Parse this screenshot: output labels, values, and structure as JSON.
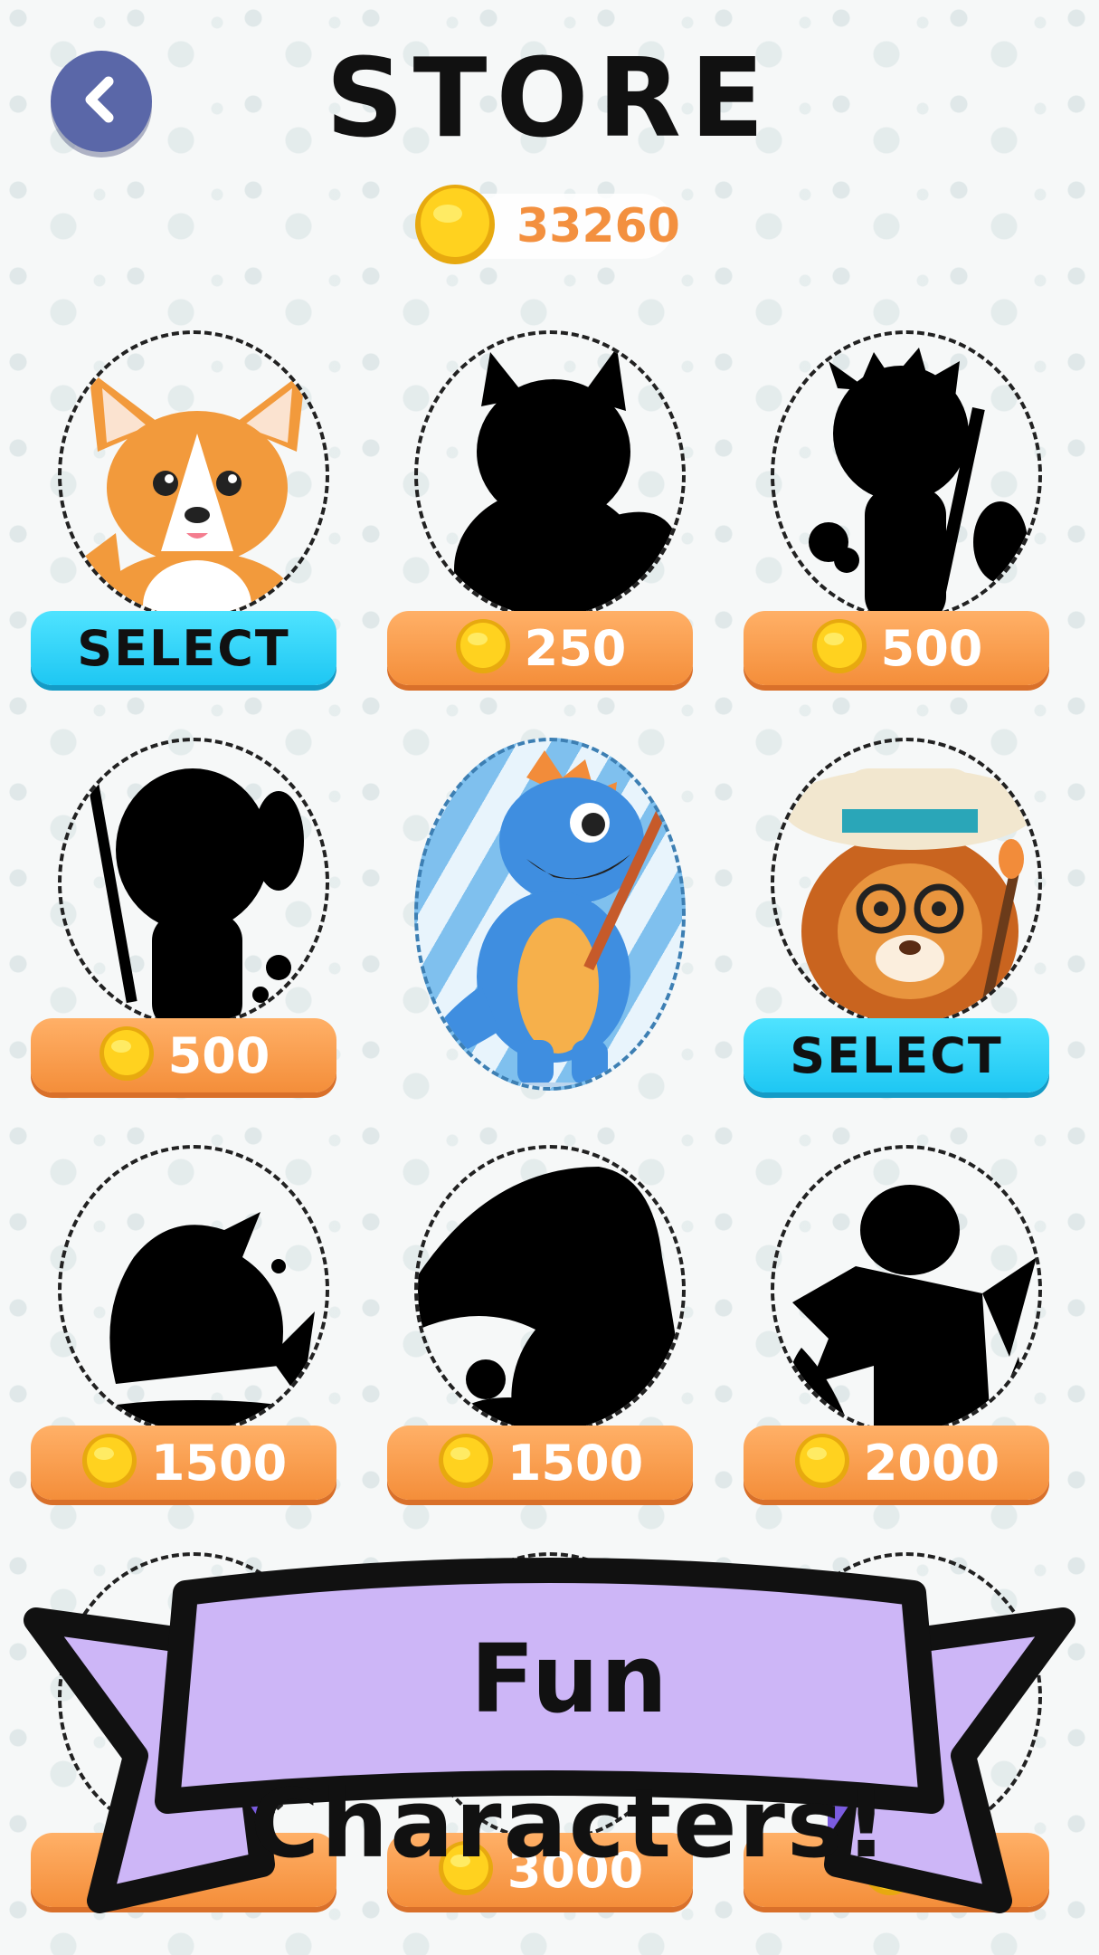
{
  "header": {
    "title": "STORE",
    "back_label": "Back"
  },
  "balance": {
    "coins": "33260"
  },
  "store": {
    "items": [
      {
        "state": "owned",
        "label": "SELECT",
        "character": "fox"
      },
      {
        "state": "locked",
        "price": "250",
        "character": "wolf-silhouette"
      },
      {
        "state": "locked",
        "price": "500",
        "character": "boy-painter-silhouette"
      },
      {
        "state": "locked",
        "price": "500",
        "character": "girl-painter-silhouette"
      },
      {
        "state": "selected",
        "character": "blue-dinosaur"
      },
      {
        "state": "owned",
        "label": "SELECT",
        "character": "lion"
      },
      {
        "state": "locked",
        "price": "1500",
        "character": "creature-silhouette"
      },
      {
        "state": "locked",
        "price": "1500",
        "character": "toucan-silhouette"
      },
      {
        "state": "locked",
        "price": "2000",
        "character": "dragon-silhouette"
      },
      {
        "state": "locked",
        "price": "",
        "character": "hidden"
      },
      {
        "state": "locked",
        "price": "3000",
        "character": "hidden"
      },
      {
        "state": "locked",
        "price": "",
        "character": "hidden"
      }
    ]
  },
  "banner": {
    "text": "Fun Characters!"
  },
  "colors": {
    "price_button": "#f48e3a",
    "select_button": "#1ec7f3",
    "coin_text": "#f3903f",
    "back_button": "#5a67a8",
    "banner_fill": "#cdb6f7"
  }
}
